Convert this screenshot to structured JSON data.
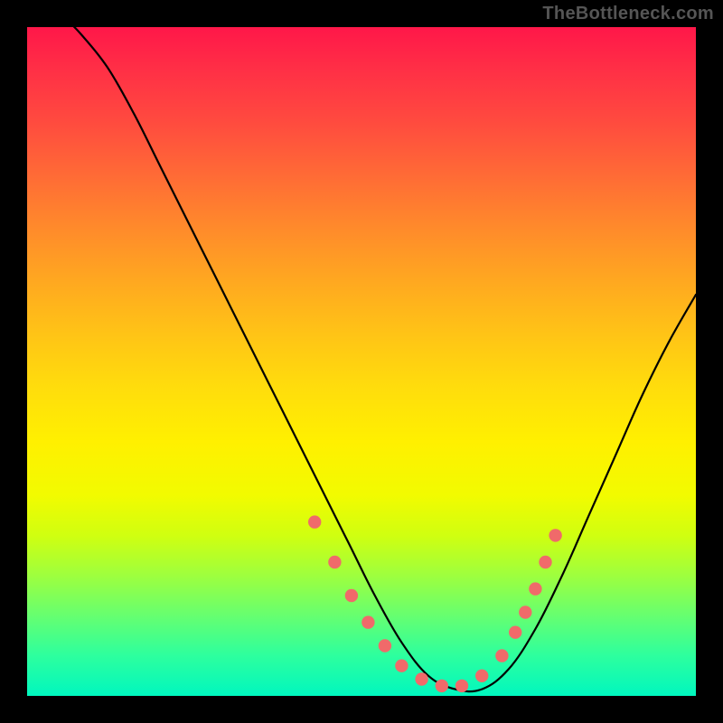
{
  "watermark": "TheBottleneck.com",
  "chart_data": {
    "type": "line",
    "title": "",
    "xlabel": "",
    "ylabel": "",
    "xlim": [
      0,
      100
    ],
    "ylim": [
      0,
      100
    ],
    "grid": false,
    "legend": false,
    "series": [
      {
        "name": "bottleneck-curve",
        "x": [
          5,
          8,
          12,
          16,
          20,
          24,
          28,
          32,
          36,
          40,
          44,
          48,
          52,
          56,
          60,
          64,
          68,
          72,
          76,
          80,
          84,
          88,
          92,
          96,
          100
        ],
        "y": [
          102,
          99,
          94,
          87,
          79,
          71,
          63,
          55,
          47,
          39,
          31,
          23,
          15,
          8,
          3,
          1,
          1,
          4,
          10,
          18,
          27,
          36,
          45,
          53,
          60
        ]
      }
    ],
    "markers": {
      "name": "highlight-dots",
      "x": [
        43,
        46,
        48.5,
        51,
        53.5,
        56,
        59,
        62,
        65,
        68,
        71,
        73,
        74.5,
        76,
        77.5,
        79
      ],
      "y": [
        26,
        20,
        15,
        11,
        7.5,
        4.5,
        2.5,
        1.5,
        1.5,
        3,
        6,
        9.5,
        12.5,
        16,
        20,
        24
      ]
    },
    "background_gradient": {
      "top": "#ff1749",
      "bottom": "#00f7bf"
    }
  }
}
